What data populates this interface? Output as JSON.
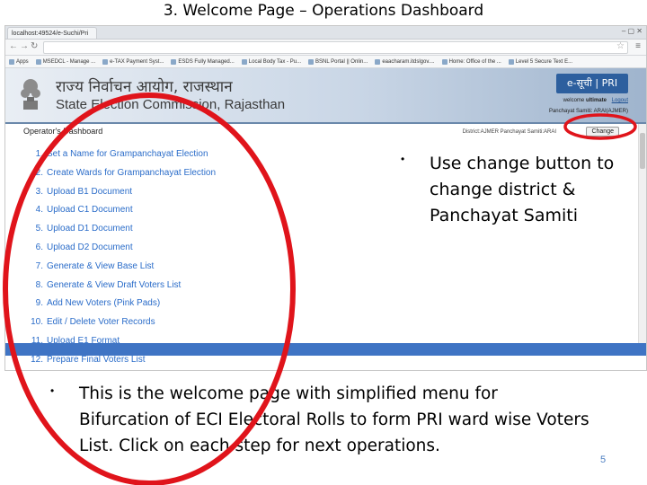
{
  "slide": {
    "title": "3. Welcome Page – Operations Dashboard",
    "page_number": "5"
  },
  "browser": {
    "tab_title": "localhost:49524/e-Suchi/Pri",
    "window_controls": "–  ▢  ✕",
    "bookmarks": [
      "Apps",
      "MSEDCL - Manage ...",
      "e-TAX Payment Syst...",
      "ESDS Fully Managed...",
      "Local Body Tax - Pu...",
      "BSNL Portal || Onlin...",
      "eaacharam.itdslgov....",
      "Home: Office of the ...",
      "Level 5 Secure Text E..."
    ]
  },
  "site": {
    "title_hindi": "राज्य निर्वाचन आयोग, राजस्थान",
    "title_english": "State Election Commission, Rajasthan",
    "brand": "e-सूची | PRI",
    "welcome_label": "welcome",
    "user": "ultimate",
    "logout_label": "Logout",
    "samiti": "Panchayat Samiti: ARAI(AJMER)"
  },
  "dashboard": {
    "title": "Operator's Dashboard",
    "district_text": "District:AJMER  Panchayat Samiti:ARAI",
    "change_label": "Change",
    "menu": [
      {
        "num": "1.",
        "label": "Set a Name for Grampanchayat Election"
      },
      {
        "num": "2.",
        "label": "Create Wards for Grampanchayat Election"
      },
      {
        "num": "3.",
        "label": "Upload B1 Document"
      },
      {
        "num": "4.",
        "label": "Upload C1 Document"
      },
      {
        "num": "5.",
        "label": "Upload D1 Document"
      },
      {
        "num": "6.",
        "label": "Upload D2 Document"
      },
      {
        "num": "7.",
        "label": "Generate & View Base List"
      },
      {
        "num": "8.",
        "label": "Generate & View Draft Voters List"
      },
      {
        "num": "9.",
        "label": "Add New Voters (Pink Pads)"
      },
      {
        "num": "10.",
        "label": "Edit / Delete Voter Records"
      },
      {
        "num": "11.",
        "label": "Upload E1 Format"
      },
      {
        "num": "12.",
        "label": "Prepare Final Voters List"
      }
    ]
  },
  "notes": {
    "change_hint": "Use change button to change district & Panchayat Samiti",
    "welcome_hint": "This is the welcome page with simplified menu for Bifurcation of ECI Electoral Rolls to form PRI ward wise Voters List. Click on each step for next operations."
  },
  "colors": {
    "annotation_red": "#e0141b",
    "menu_link": "#2a6cc9",
    "footer_blue": "#3f74c4"
  }
}
